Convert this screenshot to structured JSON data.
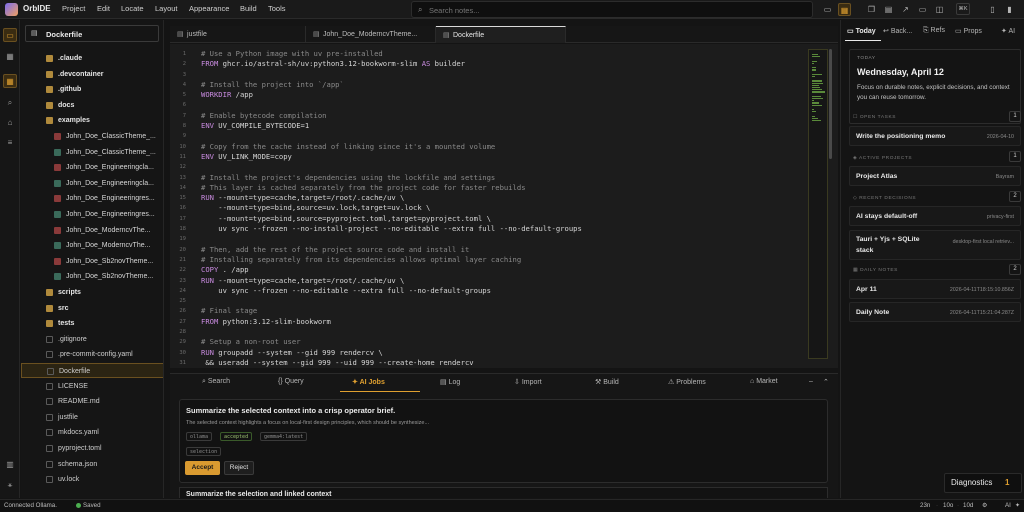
{
  "app": {
    "name": "OrbIDE"
  },
  "menu": [
    "Project",
    "Edit",
    "Locate",
    "Layout",
    "Appearance",
    "Build",
    "Tools"
  ],
  "search": {
    "placeholder": "Search notes..."
  },
  "topbar": {
    "shortcut": "⌘K"
  },
  "explorer": {
    "title": "Dockerfile",
    "items": [
      {
        "label": ".claude",
        "kind": "folder"
      },
      {
        "label": ".devcontainer",
        "kind": "folder"
      },
      {
        "label": ".github",
        "kind": "folder"
      },
      {
        "label": "docs",
        "kind": "folder"
      },
      {
        "label": "examples",
        "kind": "folder"
      },
      {
        "label": "John_Doe_ClassicTheme_...",
        "kind": "tex"
      },
      {
        "label": "John_Doe_ClassicTheme_...",
        "kind": "tex-alt"
      },
      {
        "label": "John_Doe_Engineeringcla...",
        "kind": "tex"
      },
      {
        "label": "John_Doe_Engineeringcla...",
        "kind": "tex-alt"
      },
      {
        "label": "John_Doe_Engineeringres...",
        "kind": "tex"
      },
      {
        "label": "John_Doe_Engineeringres...",
        "kind": "tex-alt"
      },
      {
        "label": "John_Doe_ModerncvThe...",
        "kind": "tex"
      },
      {
        "label": "John_Doe_ModerncvThe...",
        "kind": "tex-alt"
      },
      {
        "label": "John_Doe_Sb2novTheme...",
        "kind": "tex"
      },
      {
        "label": "John_Doe_Sb2novTheme...",
        "kind": "tex-alt"
      },
      {
        "label": "scripts",
        "kind": "folder"
      },
      {
        "label": "src",
        "kind": "folder"
      },
      {
        "label": "tests",
        "kind": "folder"
      },
      {
        "label": ".gitignore",
        "kind": "file"
      },
      {
        "label": ".pre-commit-config.yaml",
        "kind": "file"
      },
      {
        "label": "Dockerfile",
        "kind": "file",
        "selected": true
      },
      {
        "label": "LICENSE",
        "kind": "file"
      },
      {
        "label": "README.md",
        "kind": "file"
      },
      {
        "label": "justfile",
        "kind": "file"
      },
      {
        "label": "mkdocs.yaml",
        "kind": "file"
      },
      {
        "label": "pyproject.toml",
        "kind": "file"
      },
      {
        "label": "schema.json",
        "kind": "file"
      },
      {
        "label": "uv.lock",
        "kind": "file"
      }
    ]
  },
  "tabs": [
    {
      "label": "justfile"
    },
    {
      "label": "John_Doe_ModerncvTheme..."
    },
    {
      "label": "Dockerfile",
      "active": true
    }
  ],
  "editor": {
    "lines": [
      {
        "text": "# Use a Python image with uv pre-installed",
        "type": "comment"
      },
      {
        "kw": "FROM",
        "text": " ghcr.io/astral-sh/uv:python3.12-bookworm-slim ",
        "kw2": "AS",
        "text2": " builder"
      },
      {
        "text": "",
        "type": "blank"
      },
      {
        "text": "# Install the project into `/app`",
        "type": "comment"
      },
      {
        "kw": "WORKDIR",
        "text": " /app"
      },
      {
        "text": "",
        "type": "blank"
      },
      {
        "text": "# Enable bytecode compilation",
        "type": "comment"
      },
      {
        "kw": "ENV",
        "text": " UV_COMPILE_BYTECODE=1"
      },
      {
        "text": "",
        "type": "blank"
      },
      {
        "text": "# Copy from the cache instead of linking since it's a mounted volume",
        "type": "comment"
      },
      {
        "kw": "ENV",
        "text": " UV_LINK_MODE=copy"
      },
      {
        "text": "",
        "type": "blank"
      },
      {
        "text": "# Install the project's dependencies using the lockfile and settings",
        "type": "comment"
      },
      {
        "text": "# This layer is cached separately from the project code for faster rebuilds",
        "type": "comment"
      },
      {
        "kw": "RUN",
        "text": " --mount=type=cache,target=/root/.cache/uv \\"
      },
      {
        "text": "    --mount=type=bind,source=uv.lock,target=uv.lock \\"
      },
      {
        "text": "    --mount=type=bind,source=pyproject.toml,target=pyproject.toml \\"
      },
      {
        "text": "    uv sync --frozen --no-install-project --no-editable --extra full --no-default-groups"
      },
      {
        "text": "",
        "type": "blank"
      },
      {
        "text": "# Then, add the rest of the project source code and install it",
        "type": "comment"
      },
      {
        "text": "# Installing separately from its dependencies allows optimal layer caching",
        "type": "comment"
      },
      {
        "kw": "COPY",
        "text": " . /app"
      },
      {
        "kw": "RUN",
        "text": " --mount=type=cache,target=/root/.cache/uv \\"
      },
      {
        "text": "    uv sync --frozen --no-editable --extra full --no-default-groups"
      },
      {
        "text": "",
        "type": "blank"
      },
      {
        "text": "# Final stage",
        "type": "comment"
      },
      {
        "kw": "FROM",
        "text": " python:3.12-slim-bookworm"
      },
      {
        "text": "",
        "type": "blank"
      },
      {
        "text": "# Setup a non-root user",
        "type": "comment"
      },
      {
        "kw": "RUN",
        "text": " groupadd --system --gid 999 rendercv \\"
      },
      {
        "text": " && useradd --system --gid 999 --uid 999 --create-home rendercv"
      }
    ]
  },
  "panel": {
    "tabs": [
      {
        "label": "Search",
        "icon": "search-icon"
      },
      {
        "label": "Query",
        "icon": "braces-icon"
      },
      {
        "label": "AI Jobs",
        "icon": "sparkle-icon",
        "active": true
      },
      {
        "label": "Log",
        "icon": "log-icon"
      },
      {
        "label": "Import",
        "icon": "import-icon"
      },
      {
        "label": "Build",
        "icon": "hammer-icon"
      },
      {
        "label": "Problems",
        "icon": "warning-icon"
      },
      {
        "label": "Market",
        "icon": "market-icon"
      }
    ],
    "job": {
      "title": "Summarize the selected context into a crisp operator brief.",
      "body": "The selected context highlights a focus on local-first design principles, which should be synthesize...",
      "chips": [
        "ollama",
        "accepted",
        "gemma4:latest"
      ],
      "chip_selection": "selection",
      "accept": "Accept",
      "reject": "Reject"
    },
    "job2_title": "Summarize the selection and linked context"
  },
  "right": {
    "tabs": [
      "Today",
      "Back...",
      "Refs",
      "Props",
      "AI"
    ],
    "today": {
      "label": "TODAY",
      "date": "Wednesday, April 12",
      "text": "Focus on durable notes, explicit decisions, and context you can reuse tomorrow."
    },
    "open_tasks": {
      "label": "OPEN TASKS",
      "count": "1",
      "items": [
        {
          "title": "Write the positioning memo",
          "meta": "2026-04-10"
        }
      ]
    },
    "active_projects": {
      "label": "ACTIVE PROJECTS",
      "count": "1",
      "items": [
        {
          "title": "Project Atlas",
          "meta": "Bayram"
        }
      ]
    },
    "recent_decisions": {
      "label": "RECENT DECISIONS",
      "count": "2",
      "items": [
        {
          "title": "AI stays default-off",
          "meta": "privacy-first"
        },
        {
          "title": "Tauri + Yjs + SQLite",
          "title2": "stack",
          "meta": "desktop-first local retriev..."
        }
      ]
    },
    "daily_notes": {
      "label": "DAILY NOTES",
      "count": "2",
      "items": [
        {
          "title": "Apr 11",
          "meta": "2026-04-11T18:15:10.856Z"
        },
        {
          "title": "Daily Note",
          "meta": "2026-04-11T15:21:04.287Z"
        }
      ]
    }
  },
  "diagnostics": {
    "label": "Diagnostics",
    "count": "1"
  },
  "status": {
    "connection": "Connected Ollama.",
    "saved": "Saved",
    "words": "23n",
    "counts": "10o",
    "lines": "10d",
    "ai": "AI"
  },
  "colors": {
    "accent": "#e0a030",
    "background": "#141414",
    "editor": "#1c1c1c"
  }
}
